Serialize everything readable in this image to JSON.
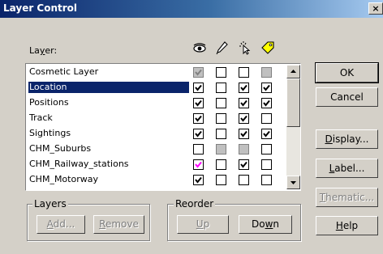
{
  "window": {
    "title": "Layer Control",
    "close_glyph": "×"
  },
  "layer_header": "Layer:",
  "column_icons": [
    "visible-eye-icon",
    "editable-pencil-icon",
    "selectable-arrow-icon",
    "autolabel-tag-icon"
  ],
  "colors": {
    "selection": "#0a246a",
    "title_start": "#0a246a",
    "title_end": "#a6caf0",
    "face": "#d4d0c8",
    "magenta_check": "#ff00ff"
  },
  "layers": [
    {
      "name": "Cosmetic Layer",
      "visible": "checked-grey",
      "editable": "unchecked",
      "selectable": "unchecked",
      "autolabel": "unchecked-grey"
    },
    {
      "name": "Location",
      "selected": true,
      "visible": "checked",
      "editable": "unchecked",
      "selectable": "checked",
      "autolabel": "checked"
    },
    {
      "name": "Positions",
      "visible": "checked",
      "editable": "unchecked",
      "selectable": "checked",
      "autolabel": "checked"
    },
    {
      "name": "Track",
      "visible": "checked",
      "editable": "unchecked",
      "selectable": "checked",
      "autolabel": "unchecked"
    },
    {
      "name": "Sightings",
      "visible": "checked",
      "editable": "unchecked",
      "selectable": "checked",
      "autolabel": "checked"
    },
    {
      "name": "CHM_Suburbs",
      "visible": "unchecked",
      "editable": "unchecked-grey",
      "selectable": "unchecked-grey",
      "autolabel": "unchecked"
    },
    {
      "name": "CHM_Railway_stations",
      "visible": "checked-magenta",
      "editable": "unchecked",
      "selectable": "checked",
      "autolabel": "unchecked"
    },
    {
      "name": "CHM_Motorway",
      "visible": "checked",
      "editable": "unchecked",
      "selectable": "unchecked",
      "autolabel": "unchecked"
    }
  ],
  "buttons": {
    "ok": "OK",
    "cancel": "Cancel",
    "display": "Display...",
    "label": "Label...",
    "thematic": "Thematic...",
    "help": "Help"
  },
  "layers_group": {
    "title": "Layers",
    "add": "Add...",
    "remove": "Remove"
  },
  "reorder_group": {
    "title": "Reorder",
    "up": "Up",
    "down": "Down"
  }
}
